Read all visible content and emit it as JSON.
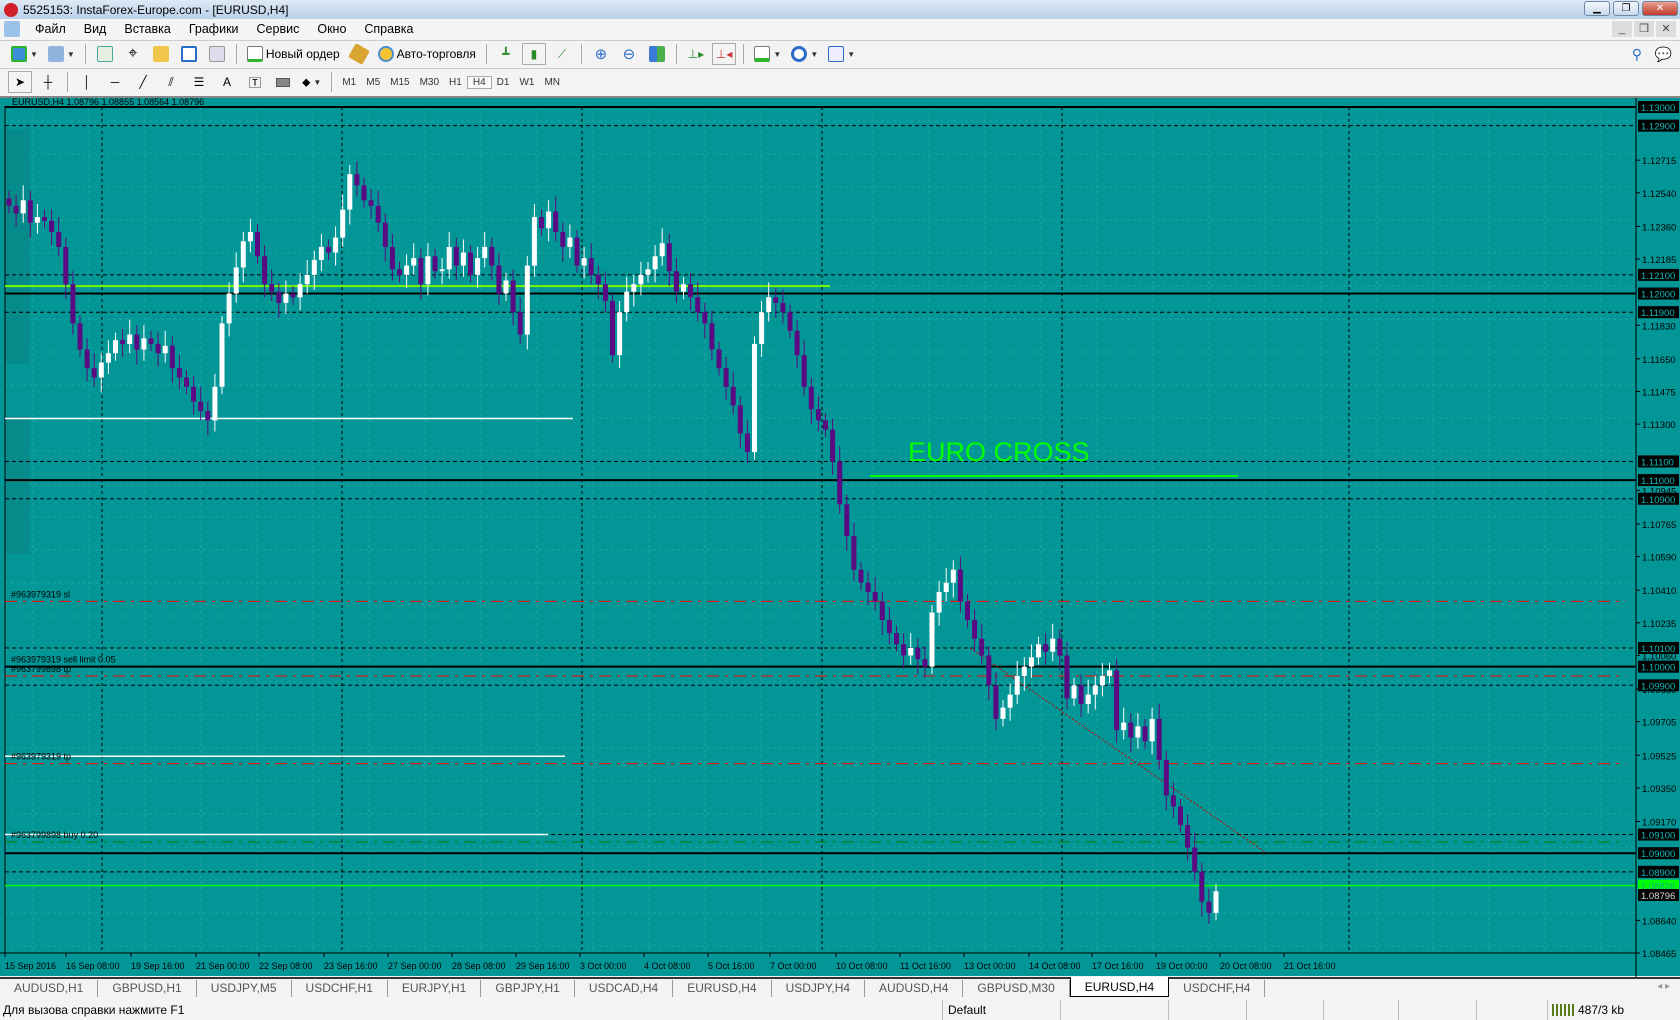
{
  "window": {
    "title": "5525153: InstaForex-Europe.com - [EURUSD,H4]"
  },
  "menu": [
    "Файл",
    "Вид",
    "Вставка",
    "Графики",
    "Сервис",
    "Окно",
    "Справка"
  ],
  "toolbar": {
    "new_order": "Новый ордер",
    "auto_trading": "Авто-торговля"
  },
  "timeframes": [
    "M1",
    "M5",
    "M15",
    "M30",
    "H1",
    "H4",
    "D1",
    "W1",
    "MN"
  ],
  "active_timeframe": "H4",
  "chart": {
    "header": "EURUSD,H4  1.08796 1.08855 1.08564 1.08796",
    "annotation": "EURO CROSS",
    "colors": {
      "background": "#029696",
      "bull": "#ffffff",
      "bear": "#5a0a82",
      "annotation": "#00ff00",
      "bid": "#00ff00"
    },
    "price_range": [
      1.08465,
      1.13
    ],
    "closes": [
      1.1247,
      1.1243,
      1.125,
      1.1238,
      1.1241,
      1.1239,
      1.1233,
      1.1225,
      1.1205,
      1.1184,
      1.117,
      1.116,
      1.1155,
      1.1163,
      1.1168,
      1.1175,
      1.1173,
      1.1178,
      1.117,
      1.1176,
      1.1173,
      1.1168,
      1.1172,
      1.116,
      1.1155,
      1.115,
      1.1142,
      1.1137,
      1.1132,
      1.115,
      1.1184,
      1.12,
      1.1214,
      1.1228,
      1.1233,
      1.122,
      1.1205,
      1.1201,
      1.1195,
      1.12,
      1.1198,
      1.1205,
      1.121,
      1.1218,
      1.1225,
      1.1222,
      1.123,
      1.1245,
      1.1264,
      1.1258,
      1.125,
      1.1247,
      1.1238,
      1.1225,
      1.1213,
      1.121,
      1.1215,
      1.1219,
      1.1205,
      1.122,
      1.1212,
      1.1213,
      1.1225,
      1.1215,
      1.1222,
      1.121,
      1.1219,
      1.1225,
      1.1215,
      1.12,
      1.1207,
      1.119,
      1.1178,
      1.1215,
      1.1241,
      1.1235,
      1.1244,
      1.1233,
      1.1225,
      1.123,
      1.1215,
      1.1219,
      1.121,
      1.1205,
      1.1196,
      1.1167,
      1.119,
      1.1201,
      1.1205,
      1.121,
      1.1213,
      1.122,
      1.1227,
      1.1212,
      1.1201,
      1.1205,
      1.1198,
      1.119,
      1.1184,
      1.117,
      1.116,
      1.115,
      1.114,
      1.1125,
      1.1115,
      1.1173,
      1.119,
      1.1198,
      1.1195,
      1.119,
      1.118,
      1.1167,
      1.115,
      1.1138,
      1.1132,
      1.1127,
      1.111,
      1.1087,
      1.107,
      1.1052,
      1.1045,
      1.104,
      1.1035,
      1.1025,
      1.1018,
      1.1012,
      1.1006,
      1.101,
      1.1004,
      1.1,
      1.1029,
      1.104,
      1.1045,
      1.1052,
      1.1035,
      1.1025,
      1.1015,
      1.1006,
      1.099,
      1.0972,
      1.0978,
      1.0985,
      1.0995,
      1.1,
      1.1005,
      1.1012,
      1.1008,
      1.1015,
      1.1006,
      1.0983,
      1.099,
      1.098,
      1.0985,
      1.099,
      1.0995,
      1.0998,
      1.0966,
      1.097,
      1.0962,
      1.0968,
      1.096,
      1.0972,
      1.095,
      1.0931,
      1.0925,
      1.0915,
      1.0903,
      1.089,
      1.0874,
      1.0868,
      1.08796
    ],
    "solid_levels": [
      "1.13000",
      "1.12000",
      "1.11000",
      "1.10000",
      "1.09000"
    ],
    "dashed_levels": [
      "1.12900",
      "1.12100",
      "1.11900",
      "1.11100",
      "1.10900",
      "1.10100",
      "1.09900",
      "1.09100",
      "1.08900"
    ],
    "axis_ticks": [
      "1.12715",
      "1.12540",
      "1.12360",
      "1.12185",
      "1.11830",
      "1.11650",
      "1.11475",
      "1.11300",
      "1.10945",
      "1.10765",
      "1.10590",
      "1.10410",
      "1.10235",
      "1.10060",
      "1.09880",
      "1.09705",
      "1.09525",
      "1.09350",
      "1.09170",
      "1.08640",
      "1.08465"
    ],
    "current_price": "1.08796",
    "bid_price": "1.08826",
    "order_lines": [
      {
        "label": "#963979319 sl",
        "price": 1.1035,
        "color": "#ff0000"
      },
      {
        "label": "#963979319 sell limit 0.05",
        "price": 1.1,
        "color": "#000000"
      },
      {
        "label": "#963799898 tp",
        "price": 1.0995,
        "color": "#ff0000"
      },
      {
        "label": "#963979319 tp",
        "price": 1.0948,
        "color": "#ff0000"
      },
      {
        "label": "#963799898 buy 0.20",
        "price": 1.0906,
        "color": "#008000"
      }
    ],
    "dates": [
      "15 Sep 2016",
      "16 Sep 08:00",
      "19 Sep 16:00",
      "21 Sep 00:00",
      "22 Sep 08:00",
      "23 Sep 16:00",
      "27 Sep 00:00",
      "28 Sep 08:00",
      "29 Sep 16:00",
      "3 Oct 00:00",
      "4 Oct 08:00",
      "5 Oct 16:00",
      "7 Oct 00:00",
      "10 Oct 08:00",
      "11 Oct 16:00",
      "13 Oct 00:00",
      "14 Oct 08:00",
      "17 Oct 16:00",
      "19 Oct 00:00",
      "20 Oct 08:00",
      "21 Oct 16:00"
    ]
  },
  "tabs": [
    "AUDUSD,H1",
    "GBPUSD,H1",
    "USDJPY,M5",
    "USDCHF,H1",
    "EURJPY,H1",
    "GBPJPY,H1",
    "USDCAD,H4",
    "EURUSD,H4",
    "USDJPY,H4",
    "AUDUSD,H4",
    "GBPUSD,M30",
    "EURUSD,H4",
    "USDCHF,H4"
  ],
  "active_tab_index": 11,
  "status": {
    "help": "Для вызова справки нажмите F1",
    "profile": "Default",
    "traffic": "487/3 kb"
  }
}
